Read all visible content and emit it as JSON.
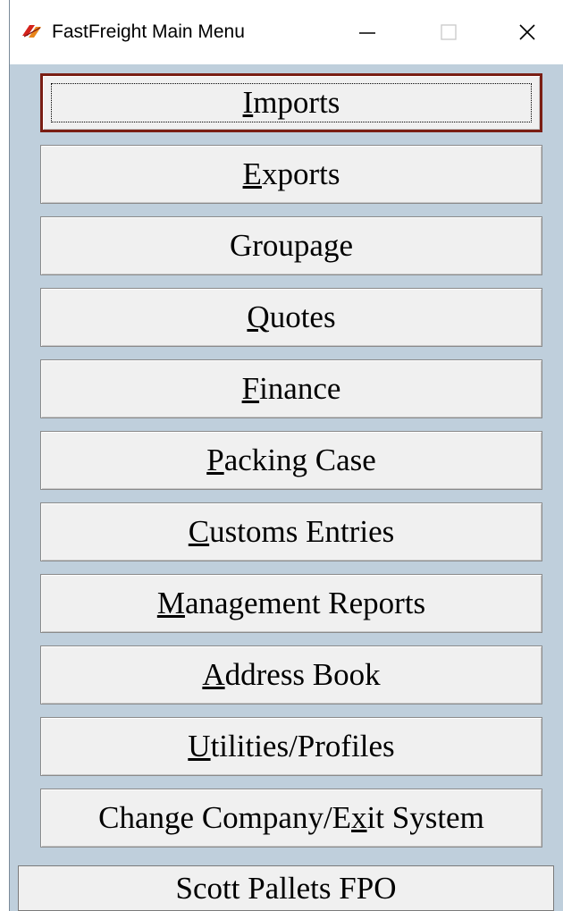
{
  "window": {
    "title": "FastFreight Main Menu",
    "minimize_glyph": "—",
    "close_glyph": "✕"
  },
  "menu": {
    "buttons": [
      {
        "pre": "",
        "key": "I",
        "post": "mports",
        "focused": true
      },
      {
        "pre": "",
        "key": "E",
        "post": "xports",
        "focused": false
      },
      {
        "pre": "Groupage",
        "key": "",
        "post": "",
        "focused": false
      },
      {
        "pre": "",
        "key": "Q",
        "post": "uotes",
        "focused": false
      },
      {
        "pre": "",
        "key": "F",
        "post": "inance",
        "focused": false
      },
      {
        "pre": "",
        "key": "P",
        "post": "acking Case",
        "focused": false
      },
      {
        "pre": "",
        "key": "C",
        "post": "ustoms Entries",
        "focused": false
      },
      {
        "pre": "",
        "key": "M",
        "post": "anagement Reports",
        "focused": false
      },
      {
        "pre": "",
        "key": "A",
        "post": "ddress Book",
        "focused": false
      },
      {
        "pre": "",
        "key": "U",
        "post": "tilities/Profiles",
        "focused": false
      },
      {
        "pre": "Change Company/E",
        "key": "x",
        "post": "it System",
        "focused": false
      }
    ]
  },
  "status": {
    "company": "Scott Pallets FPO"
  },
  "colors": {
    "window_bg": "#bfcfdc",
    "button_face": "#f0f0f0",
    "focus_border": "#7a1e14"
  }
}
